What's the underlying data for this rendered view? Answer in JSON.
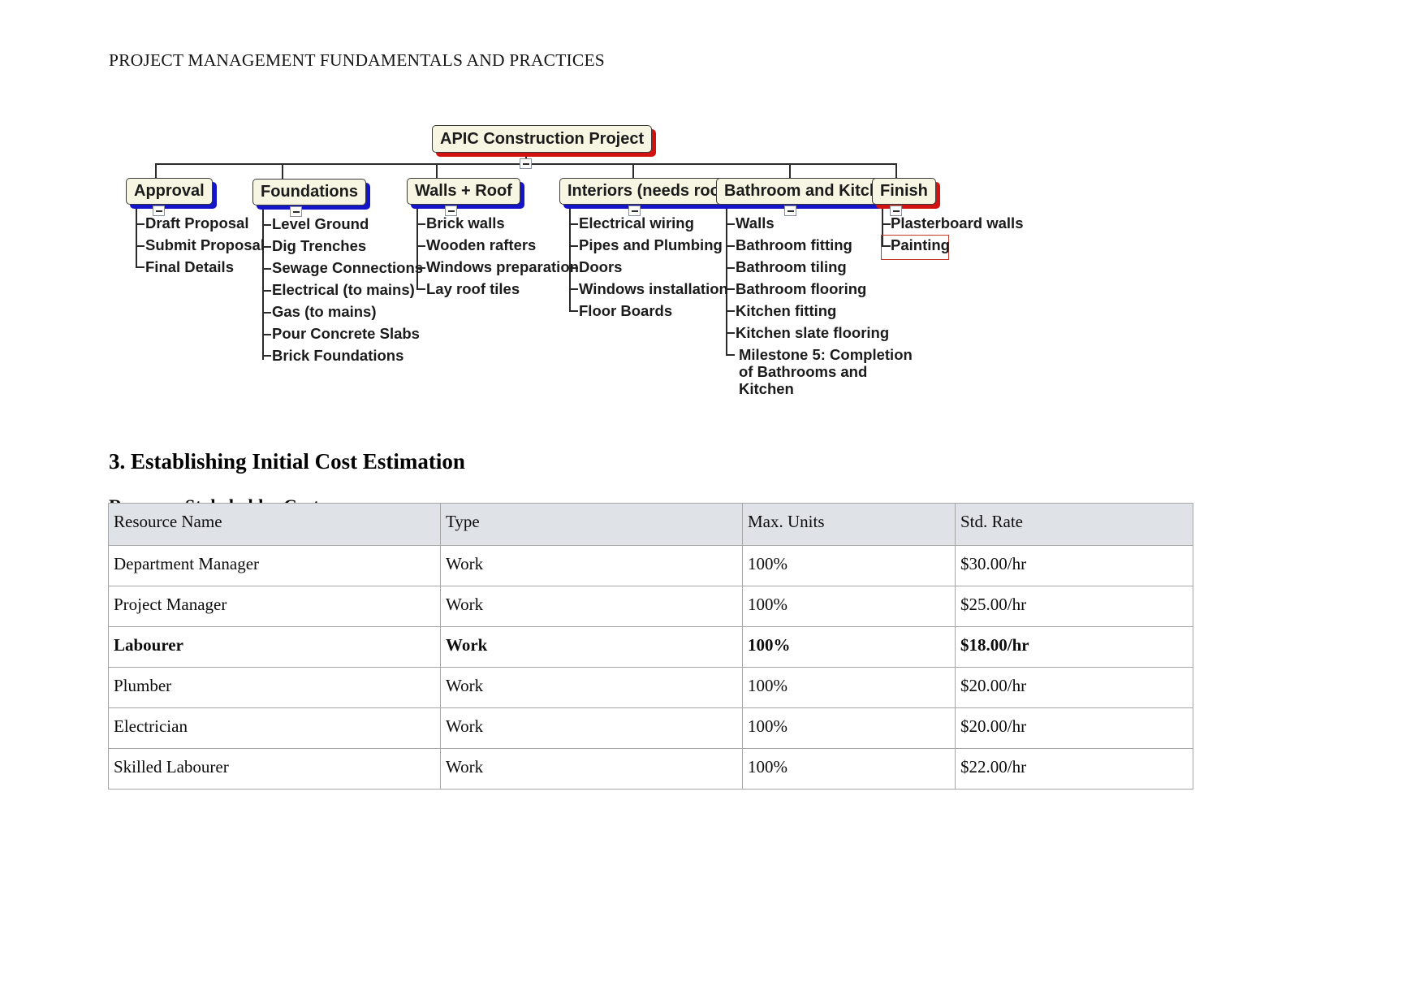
{
  "document": {
    "running_header": "PROJECT MANAGEMENT FUNDAMENTALS AND PRACTICES",
    "section_heading": "3. Establishing Initial Cost Estimation",
    "subsection_heading": "Resource Stakeholder Cost"
  },
  "wbs": {
    "root": {
      "label": "APIC Construction Project"
    },
    "branches": [
      {
        "label": "Approval",
        "children": [
          "Draft Proposal",
          "Submit Proposal",
          "Final Details"
        ]
      },
      {
        "label": "Foundations",
        "children": [
          "Level Ground",
          "Dig Trenches",
          "Sewage Connections",
          "Electrical (to mains)",
          "Gas (to mains)",
          "Pour Concrete Slabs",
          "Brick Foundations"
        ]
      },
      {
        "label": "Walls + Roof",
        "children": [
          "Brick walls",
          "Wooden rafters",
          "Windows preparation",
          "Lay roof tiles"
        ]
      },
      {
        "label": "Interiors (needs roof)",
        "children": [
          "Electrical wiring",
          "Pipes and Plumbing",
          "Doors",
          "Windows installation",
          "Floor Boards"
        ]
      },
      {
        "label": "Bathroom and Kitchen",
        "children": [
          "Walls",
          "Bathroom fitting",
          "Bathroom tiling",
          "Bathroom flooring",
          "Kitchen fitting",
          "Kitchen slate flooring",
          "Milestone 5: Completion of Bathrooms and Kitchen"
        ]
      },
      {
        "label": "Finish",
        "children": [
          "Plasterboard walls",
          "Painting"
        ]
      }
    ],
    "selected_child": "Painting",
    "colors": {
      "node_fill": "#f7f6e3",
      "node_border": "#3a3a3a",
      "shadow_blue": "#1414c8",
      "shadow_red": "#d21111",
      "selection_border": "#c0392b"
    }
  },
  "table": {
    "columns": [
      "Resource Name",
      "Type",
      "Max. Units",
      "Std. Rate"
    ],
    "rows": [
      {
        "name": "Department Manager",
        "type": "Work",
        "units": "100%",
        "rate": "$30.00/hr",
        "bold": false
      },
      {
        "name": "Project Manager",
        "type": "Work",
        "units": "100%",
        "rate": "$25.00/hr",
        "bold": false
      },
      {
        "name": "Labourer",
        "type": "Work",
        "units": "100%",
        "rate": "$18.00/hr",
        "bold": true
      },
      {
        "name": "Plumber",
        "type": "Work",
        "units": "100%",
        "rate": "$20.00/hr",
        "bold": false
      },
      {
        "name": "Electrician",
        "type": "Work",
        "units": "100%",
        "rate": "$20.00/hr",
        "bold": false
      },
      {
        "name": "Skilled Labourer",
        "type": "Work",
        "units": "100%",
        "rate": "$22.00/hr",
        "bold": false
      }
    ],
    "header_background": "#dfe3e8"
  }
}
